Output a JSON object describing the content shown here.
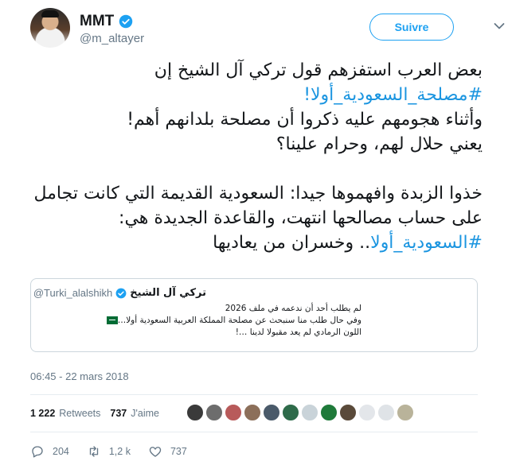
{
  "author": {
    "display_name": "MMT",
    "handle": "@m_altayer"
  },
  "follow_button_label": "Suivre",
  "tweet": {
    "lines": [
      "بعض العرب استفزهم قول تركي آل الشيخ إن",
      "#مصلحة_السعودية_أولا!",
      "وأثناء هجومهم عليه ذكروا أن مصلحة بلدانهم أهم!",
      "يعني حلال لهم، وحرام علينا؟",
      "",
      "خذوا الزبدة وافهموها جيدا: السعودية القديمة التي كانت تجامل",
      "على حساب مصالحها انتهت، والقاعدة الجديدة هي:",
      "#السعودية_أولا.. وخسران من يعاديها"
    ]
  },
  "quote": {
    "display_name": "تركي آل الشيخ",
    "handle": "@Turki_alalshikh",
    "lines": [
      "لم يطلب أحد أن ندعمه في ملف 2026",
      "وفي حال طلب منا سنبحث عن مصلحة المملكة العربية السعودية أولا…",
      "اللون الرمادي لم يعد مقبولا لدينا …!"
    ]
  },
  "timestamp": "06:45 - 22 mars 2018",
  "stats": {
    "retweets_count": "1 222",
    "retweets_label": "Retweets",
    "likes_count": "737",
    "likes_label": "J'aime"
  },
  "liker_colors": [
    "#3a3a3a",
    "#6d6d6d",
    "#b85a5a",
    "#8c6f5a",
    "#4a5a6a",
    "#2e6b4a",
    "#c9d3d9",
    "#1f7a3a",
    "#5a4a3a",
    "#e3e6ea",
    "#dfe3e7",
    "#b9b39a"
  ],
  "actions": {
    "reply_count": "204",
    "retweet_count": "1,2 k",
    "like_count": "737"
  },
  "icons": [
    "verified-icon",
    "chevron-down-icon",
    "reply-icon",
    "retweet-icon",
    "heart-icon"
  ],
  "colors": {
    "accent": "#1da1f2",
    "hashtag": "#1b95e0",
    "secondary_text": "#657786",
    "border": "#ccd6dd"
  }
}
